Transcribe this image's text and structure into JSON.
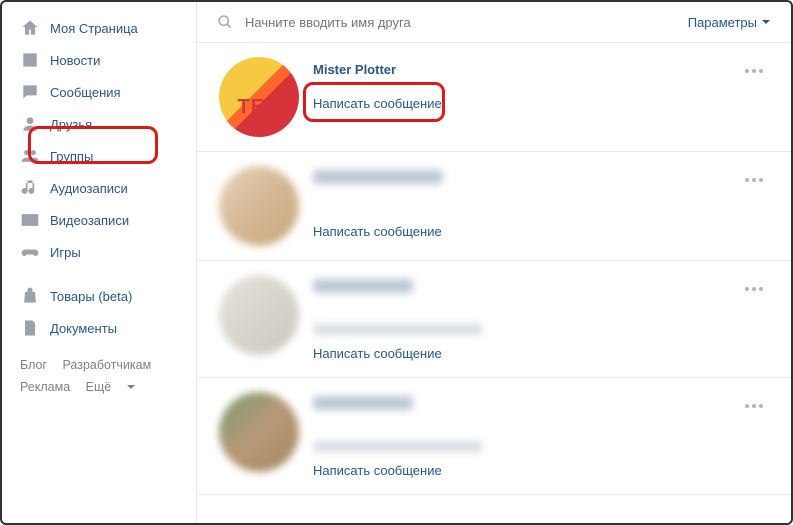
{
  "sidebar": {
    "items": [
      {
        "label": "Моя Страница"
      },
      {
        "label": "Новости"
      },
      {
        "label": "Сообщения"
      },
      {
        "label": "Друзья"
      },
      {
        "label": "Группы"
      },
      {
        "label": "Аудиозаписи"
      },
      {
        "label": "Видеозаписи"
      },
      {
        "label": "Игры"
      },
      {
        "label": "Товары (beta)"
      },
      {
        "label": "Документы"
      }
    ],
    "footer": {
      "blog": "Блог",
      "dev": "Разработчикам",
      "ads": "Реклама",
      "more": "Ещё"
    }
  },
  "search": {
    "placeholder": "Начните вводить имя друга"
  },
  "params": {
    "label": "Параметры"
  },
  "friends": [
    {
      "name": "Mister Plotter",
      "msg": "Написать сообщение"
    },
    {
      "name": "",
      "msg": "Написать сообщение"
    },
    {
      "name": "",
      "msg": "Написать сообщение"
    },
    {
      "name": "",
      "msg": "Написать сообщение"
    }
  ]
}
